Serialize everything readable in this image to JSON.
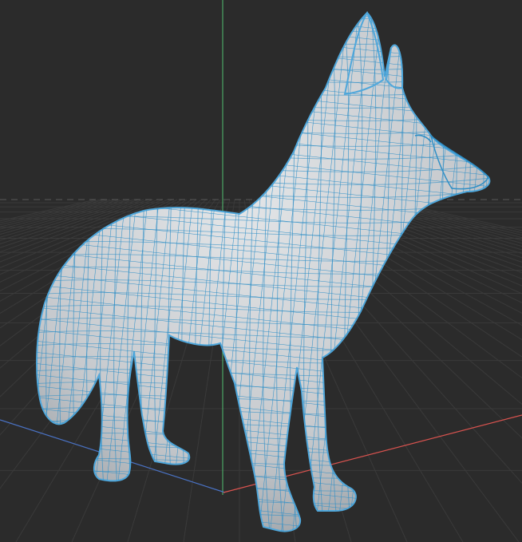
{
  "viewport": {
    "kind": "3d-viewport",
    "background_color": "#2b2b2b",
    "grid_color": "#3a3a3a",
    "horizon_color": "#5a5a5a",
    "axis_colors": {
      "x": "#d9534f",
      "y": "#4aa564",
      "z": "#4a72c4"
    }
  },
  "model": {
    "kind": "fox-wireframe-mesh",
    "surface_color": "#c9ccd0",
    "wire_color": "#2f8fc6",
    "outline_color": "#4fa7db"
  }
}
